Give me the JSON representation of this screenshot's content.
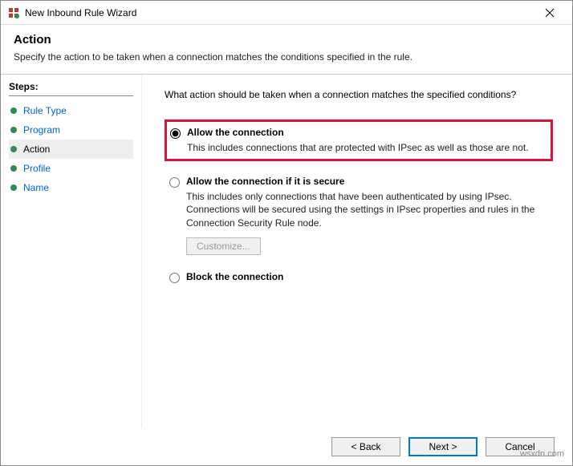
{
  "titlebar": {
    "title": "New Inbound Rule Wizard"
  },
  "header": {
    "title": "Action",
    "subtitle": "Specify the action to be taken when a connection matches the conditions specified in the rule."
  },
  "steps": {
    "label": "Steps:",
    "items": [
      {
        "label": "Rule Type",
        "active": false
      },
      {
        "label": "Program",
        "active": false
      },
      {
        "label": "Action",
        "active": true
      },
      {
        "label": "Profile",
        "active": false
      },
      {
        "label": "Name",
        "active": false
      }
    ]
  },
  "content": {
    "question": "What action should be taken when a connection matches the specified conditions?",
    "options": [
      {
        "title": "Allow the connection",
        "desc": "This includes connections that are protected with IPsec as well as those are not.",
        "checked": true,
        "highlight": true
      },
      {
        "title": "Allow the connection if it is secure",
        "desc": "This includes only connections that have been authenticated by using IPsec. Connections will be secured using the settings in IPsec properties and rules in the Connection Security Rule node.",
        "checked": false,
        "customize_label": "Customize..."
      },
      {
        "title": "Block the connection",
        "desc": "",
        "checked": false
      }
    ]
  },
  "footer": {
    "back": "< Back",
    "next": "Next >",
    "cancel": "Cancel"
  },
  "watermark": "wsxdn.com"
}
